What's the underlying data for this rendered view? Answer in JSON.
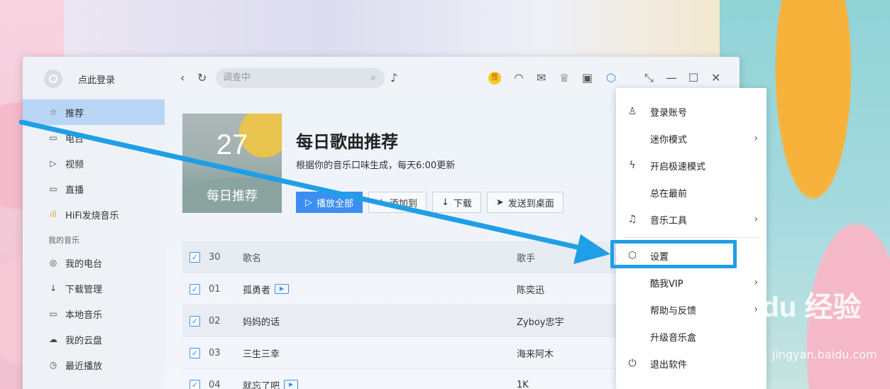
{
  "sidebar": {
    "login_text": "点此登录",
    "items": [
      {
        "label": "推荐",
        "icon": "star-icon",
        "glyph": "☆"
      },
      {
        "label": "电台",
        "icon": "radio-icon",
        "glyph": "▭"
      },
      {
        "label": "视频",
        "icon": "video-icon",
        "glyph": "▷"
      },
      {
        "label": "直播",
        "icon": "live-icon",
        "glyph": "▭"
      },
      {
        "label": "HiFi发烧音乐",
        "icon": "hifi-icon",
        "glyph": "ıll"
      }
    ],
    "section_label": "我的音乐",
    "my_items": [
      {
        "label": "我的电台",
        "icon": "location-icon",
        "glyph": "◎"
      },
      {
        "label": "下载管理",
        "icon": "download-icon",
        "glyph": "↓"
      },
      {
        "label": "本地音乐",
        "icon": "monitor-icon",
        "glyph": "▭"
      },
      {
        "label": "我的云盘",
        "icon": "cloud-icon",
        "glyph": "☁"
      },
      {
        "label": "最近播放",
        "icon": "clock-icon",
        "glyph": "◷"
      }
    ]
  },
  "topbar": {
    "search_placeholder": "调查中",
    "vip_badge": "签"
  },
  "daily": {
    "day": "27",
    "cover_label": "每日推荐",
    "title": "每日歌曲推荐",
    "subtitle": "根据你的音乐口味生成，每天6:00更新",
    "buttons": {
      "play_all": "播放全部",
      "add_to": "添加到",
      "download": "下载",
      "send_desktop": "发送到桌面"
    }
  },
  "table": {
    "count": "30",
    "col_name": "歌名",
    "col_artist": "歌手",
    "rows": [
      {
        "num": "01",
        "name": "孤勇者",
        "artist": "陈奕迅",
        "mv": true
      },
      {
        "num": "02",
        "name": "妈妈的话",
        "artist": "Zyboy忠宇",
        "mv": false
      },
      {
        "num": "03",
        "name": "三生三幸",
        "artist": "海来阿木",
        "mv": false
      },
      {
        "num": "04",
        "name": "就忘了吧",
        "artist": "1K",
        "mv": true
      }
    ]
  },
  "menu": {
    "items": [
      {
        "label": "登录账号",
        "icon": "user-icon",
        "glyph": "♙",
        "arrow": false
      },
      {
        "label": "迷你模式",
        "icon": "",
        "glyph": "",
        "arrow": true
      },
      {
        "label": "开启极速模式",
        "icon": "lightning-icon",
        "glyph": "ϟ",
        "arrow": false
      },
      {
        "label": "总在最前",
        "icon": "",
        "glyph": "",
        "arrow": false
      },
      {
        "label": "音乐工具",
        "icon": "music-tool-icon",
        "glyph": "♫",
        "arrow": true
      }
    ],
    "items2": [
      {
        "label": "设置",
        "icon": "settings-icon",
        "glyph": "⬡",
        "arrow": false
      },
      {
        "label": "酷我VIP",
        "icon": "",
        "glyph": "",
        "arrow": true
      },
      {
        "label": "帮助与反馈",
        "icon": "",
        "glyph": "",
        "arrow": true
      },
      {
        "label": "升级音乐盒",
        "icon": "",
        "glyph": "",
        "arrow": false
      },
      {
        "label": "退出软件",
        "icon": "power-icon",
        "glyph": "⏻",
        "arrow": false
      }
    ]
  },
  "colors": {
    "accent": "#3b8ff0",
    "annotation": "#1e9fe6"
  },
  "watermark": {
    "brand": "Bai du 经验",
    "url": "jingyan.baidu.com"
  }
}
